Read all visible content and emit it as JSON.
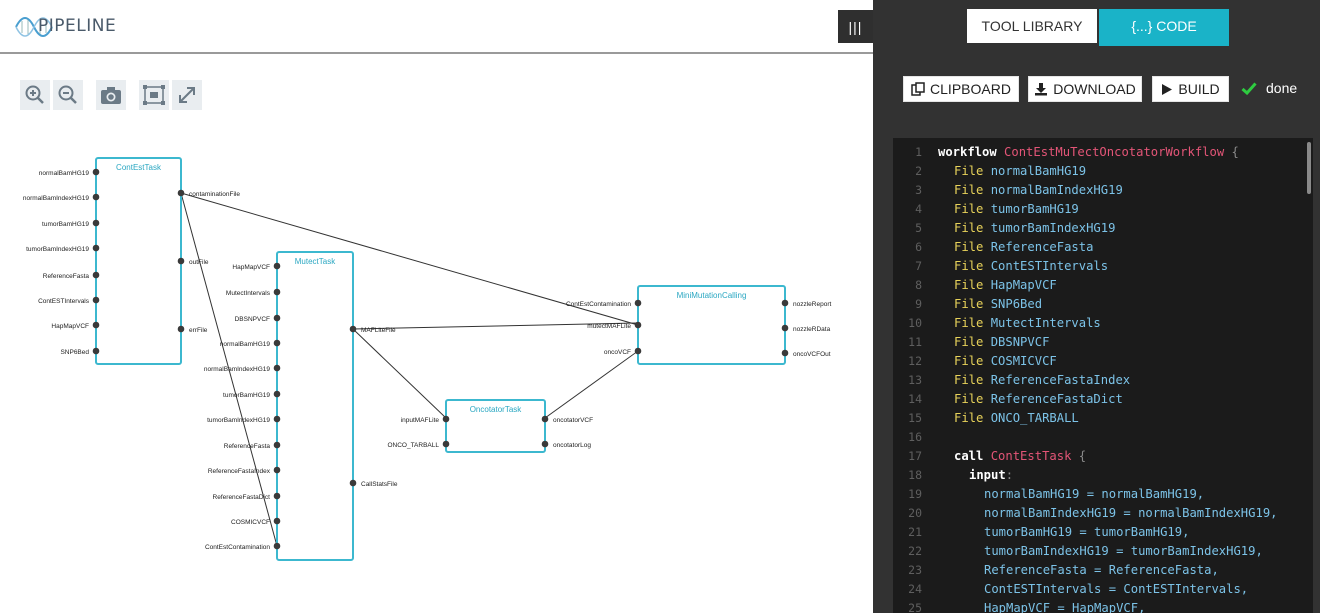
{
  "app": {
    "logo_text": "PIPELINE",
    "splitter_icon": "|||"
  },
  "toolbar": {
    "icons": [
      "zoom-in-icon",
      "zoom-out-icon",
      "camera-icon",
      "fit-icon",
      "expand-icon"
    ]
  },
  "tabs": {
    "tool_library": "TOOL LIBRARY",
    "code": "{...} CODE"
  },
  "actions": {
    "clipboard": "CLIPBOARD",
    "download": "DOWNLOAD",
    "build": "BUILD",
    "status": "done"
  },
  "colors": {
    "accent": "#1ab3c8",
    "node_border": "#3cb8cf",
    "status_ok": "#2ecc40"
  },
  "graph": {
    "conttask": {
      "title": "ContEstTask",
      "inputs": [
        "normalBamHG19",
        "normalBamIndexHG19",
        "tumorBamHG19",
        "tumorBamIndexHG19",
        "ReferenceFasta",
        "ContESTIntervals",
        "HapMapVCF",
        "SNP6Bed"
      ],
      "outputs": [
        "contaminationFile",
        "outFile",
        "errFile"
      ]
    },
    "mutect": {
      "title": "MutectTask",
      "inputs": [
        "HapMapVCF",
        "MutectIntervals",
        "DBSNPVCF",
        "normalBamHG19",
        "normalBamIndexHG19",
        "tumorBamHG19",
        "tumorBamIndexHG19",
        "ReferenceFasta",
        "ReferenceFastaIndex",
        "ReferenceFastaDict",
        "COSMICVCF",
        "ContEstContamination"
      ],
      "outputs": [
        "MAFLiteFile",
        "CallStatsFile"
      ]
    },
    "onco": {
      "title": "OncotatorTask",
      "inputs": [
        "inputMAFLite",
        "ONCO_TARBALL"
      ],
      "outputs": [
        "oncotatorVCF",
        "oncotatorLog"
      ]
    },
    "mini": {
      "title": "MiniMutationCalling",
      "inputs": [
        "ContEstContamination",
        "mutectMAFLite",
        "oncoVCF"
      ],
      "outputs": [
        "nozzleReport",
        "nozzleRData",
        "oncoVCFOut"
      ]
    }
  },
  "code": {
    "line_numbers": [
      "1",
      "2",
      "3",
      "4",
      "5",
      "6",
      "7",
      "8",
      "9",
      "10",
      "11",
      "12",
      "13",
      "14",
      "15",
      "16",
      "17",
      "18",
      "19",
      "20",
      "21",
      "22",
      "23",
      "24",
      "25"
    ],
    "workflow_kw": "workflow",
    "workflow_name": "ContEstMuTectOncotatorWorkflow",
    "open_brace": "{",
    "file_kw": "File",
    "decls": [
      "normalBamHG19",
      "normalBamIndexHG19",
      "tumorBamHG19",
      "tumorBamIndexHG19",
      "ReferenceFasta",
      "ContESTIntervals",
      "HapMapVCF",
      "SNP6Bed",
      "MutectIntervals",
      "DBSNPVCF",
      "COSMICVCF",
      "ReferenceFastaIndex",
      "ReferenceFastaDict",
      "ONCO_TARBALL"
    ],
    "call_kw": "call",
    "call_name": "ContEstTask",
    "input_kw": "input",
    "colon": ":",
    "assignments": [
      "normalBamHG19 = normalBamHG19,",
      "normalBamIndexHG19 = normalBamIndexHG19,",
      "tumorBamHG19 = tumorBamHG19,",
      "tumorBamIndexHG19 = tumorBamIndexHG19,",
      "ReferenceFasta = ReferenceFasta,",
      "ContESTIntervals = ContESTIntervals,",
      "HapMapVCF = HapMapVCF,"
    ]
  }
}
